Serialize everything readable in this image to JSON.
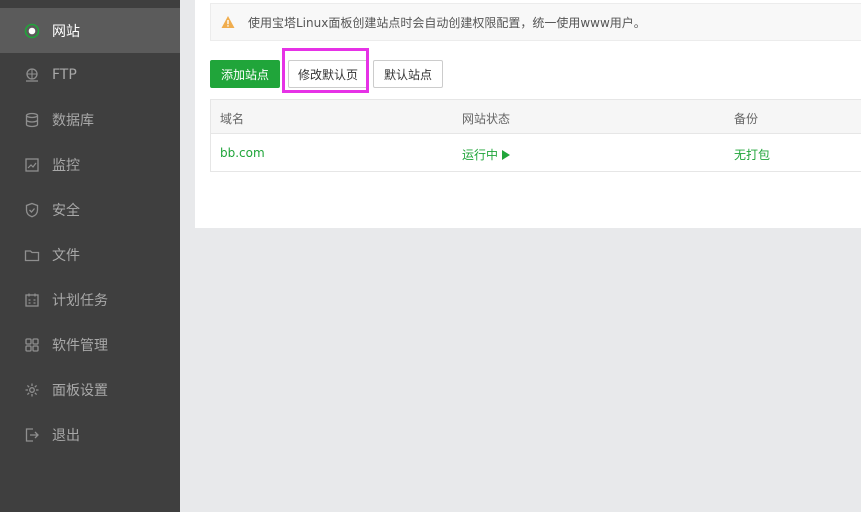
{
  "sidebar": {
    "items": [
      {
        "label": "网站",
        "icon": "globe-icon",
        "active": true
      },
      {
        "label": "FTP",
        "icon": "ftp-icon"
      },
      {
        "label": "数据库",
        "icon": "database-icon"
      },
      {
        "label": "监控",
        "icon": "monitor-icon"
      },
      {
        "label": "安全",
        "icon": "shield-icon"
      },
      {
        "label": "文件",
        "icon": "folder-icon"
      },
      {
        "label": "计划任务",
        "icon": "calendar-icon"
      },
      {
        "label": "软件管理",
        "icon": "grid-icon"
      },
      {
        "label": "面板设置",
        "icon": "gear-icon"
      },
      {
        "label": "退出",
        "icon": "logout-icon"
      }
    ]
  },
  "notice": {
    "icon": "warning-icon",
    "icon_color": "#f0ad4e",
    "text": "使用宝塔Linux面板创建站点时会自动创建权限配置，统一使用www用户。"
  },
  "toolbar": {
    "add_site_label": "添加站点",
    "edit_default_page_label": "修改默认页",
    "default_site_label": "默认站点"
  },
  "table": {
    "headers": [
      "域名",
      "网站状态",
      "备份"
    ],
    "rows": [
      {
        "domain": "bb.com",
        "status": "运行中",
        "backup": "无打包"
      }
    ]
  },
  "colors": {
    "accent": "#20a53a",
    "highlight": "#e632e6",
    "sidebar_bg": "#3f3f3f"
  }
}
